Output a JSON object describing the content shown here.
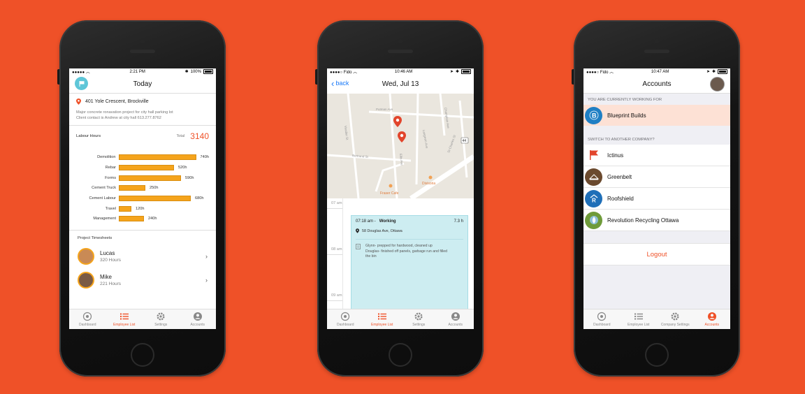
{
  "colors": {
    "background": "#ef5128",
    "accent": "#ef5128",
    "bar": "#f5a41c",
    "event": "#cdedf1",
    "link": "#1a7af8"
  },
  "tabs_standard": [
    "Dashboard",
    "Employee List",
    "Settings",
    "Accounts"
  ],
  "tabs_company": [
    "Dashboard",
    "Employee List",
    "Company Settings",
    "Accounts"
  ],
  "phone1": {
    "status": {
      "time": "2:21 PM",
      "battery": "100%"
    },
    "title": "Today",
    "address": "401 Yole Crescent, Brockville",
    "desc1": "Major concrete ronavation project for city hall parking lot",
    "desc2": "Client contact is Andrew at city hall 613.277.8762",
    "labour_title": "Labour Hours",
    "total_label": "Total",
    "total_value": "3140",
    "bars": [
      {
        "label": "Demolition",
        "value": "740h",
        "hours": 740
      },
      {
        "label": "Rebar",
        "value": "520h",
        "hours": 520
      },
      {
        "label": "Forms",
        "value": "590h",
        "hours": 590
      },
      {
        "label": "Cement Truck",
        "value": "250h",
        "hours": 250
      },
      {
        "label": "Cement Labour",
        "value": "680h",
        "hours": 680
      },
      {
        "label": "Travel",
        "value": "120h",
        "hours": 120
      },
      {
        "label": "Management",
        "value": "240h",
        "hours": 240
      }
    ],
    "timesheets_title": "Project Timesheets",
    "people": [
      {
        "name": "Lucas",
        "hours": "320 Hours"
      },
      {
        "name": "Mike",
        "hours": "221 Hours"
      }
    ],
    "active_tab": 1
  },
  "phone2": {
    "status": {
      "carrier": "Fido",
      "time": "10:46 AM"
    },
    "back_label": "back",
    "title": "Wed, Jul 13",
    "map_labels": {
      "putman": "Putman Ave",
      "langevin": "Langevin Ave",
      "champlain": "Champlain Ave",
      "st_charles": "St-Charles St",
      "bertrand": "Bertrand St",
      "vaudier": "Vaudier St",
      "ellis": "Ellis Ave",
      "route": "44",
      "fraser_cafe": "Fraser Cafe",
      "divisoria": "Divisoria"
    },
    "times": [
      "07 am",
      "08 am",
      "09 am"
    ],
    "event": {
      "time": "07:18 am -",
      "status": "Working",
      "duration": "7.3 h",
      "location": "58 Douglas Ave, Ottawa",
      "note_line1": "Glynn- prepped for hardwood, cleaned up",
      "note_line2": "Douglas- finished off panels, garbage run and filled",
      "note_line3": "the bin"
    },
    "active_tab": 1
  },
  "phone3": {
    "status": {
      "carrier": "Fido",
      "time": "10:47 AM"
    },
    "title": "Accounts",
    "current_header": "YOU ARE CURRENTLY WORKING FOR",
    "current_company": "Blueprint  Builds",
    "switch_header": "SWITCH TO ANOTHER COMPANY?",
    "companies": [
      "Ictinus",
      "Greenbelt",
      "Roofshield",
      "Revolution Recycling Ottawa"
    ],
    "logout_label": "Logout",
    "active_tab": 3
  }
}
